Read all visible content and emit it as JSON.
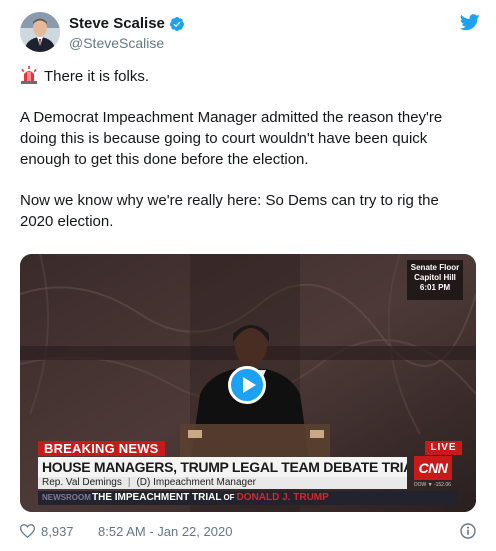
{
  "author": {
    "display_name": "Steve Scalise",
    "handle": "@SteveScalise",
    "verified": true
  },
  "icons": {
    "avatar": "avatar",
    "verified": "verified-badge-icon",
    "brand": "twitter-bird-icon",
    "siren": "police-siren-emoji",
    "play": "play-icon",
    "like": "heart-icon",
    "info": "info-icon"
  },
  "tweet": {
    "line1": "There it is folks.",
    "para1": "A Democrat Impeachment Manager admitted the reason they're doing this is because going to court wouldn't have been quick enough to get this done before the election.",
    "para2": "Now we know why we're really here: So Dems can try to rig the 2020 election."
  },
  "video": {
    "location_line1": "Senate Floor",
    "location_line2": "Capitol Hill",
    "location_time": "6:01 PM",
    "breaking": "BREAKING NEWS",
    "live": "LIVE",
    "headline": "HOUSE MANAGERS, TRUMP LEGAL TEAM DEBATE TRIAL RULES",
    "network": "CNN",
    "speaker_name": "Rep. Val Demings",
    "speaker_role": "(D) Impeachment Manager",
    "market": "DOW ▼ -152.06",
    "ticker_prefix": "NEWSROOM",
    "ticker_a": "THE IMPEACHMENT TRIAL",
    "ticker_of": "OF",
    "ticker_b": "DONALD J. TRUMP"
  },
  "footer": {
    "likes": "8,937",
    "timestamp": "8:52 AM - Jan 22, 2020"
  },
  "colors": {
    "accent": "#1da1f2",
    "cnn_red": "#c91a1a",
    "muted_text": "#657786"
  }
}
